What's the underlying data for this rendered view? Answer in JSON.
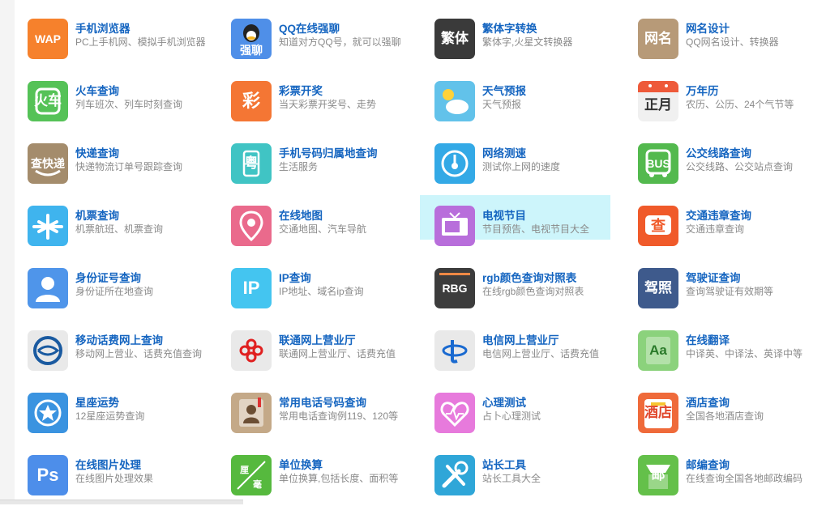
{
  "tiles": [
    {
      "title": "手机浏览器",
      "desc": "PC上手机网、模拟手机浏览器",
      "icon": "wap-icon",
      "icon_text": "WAP",
      "color": "#f6812c"
    },
    {
      "title": "QQ在线强聊",
      "desc": "知道对方QQ号，就可以强聊",
      "icon": "qq-penguin-icon",
      "icon_text": "强聊",
      "color": "#4f8fe8"
    },
    {
      "title": "繁体字转换",
      "desc": "繁体字,火星文转换器",
      "icon": "traditional-chinese-icon",
      "icon_text": "繁体",
      "color": "#3a3a3a"
    },
    {
      "title": "网名设计",
      "desc": "QQ网名设计、转换器",
      "icon": "nickname-icon",
      "icon_text": "网名",
      "color": "#b79a78"
    },
    {
      "title": "火车查询",
      "desc": "列车班次、列车时刻查询",
      "icon": "train-icon",
      "icon_text": "火车",
      "color": "#55c257"
    },
    {
      "title": "彩票开奖",
      "desc": "当天彩票开奖号、走势",
      "icon": "lottery-icon",
      "icon_text": "彩",
      "color": "#f47634"
    },
    {
      "title": "天气预报",
      "desc": "天气预报",
      "icon": "weather-icon",
      "icon_text": "",
      "color": "#62c2ea"
    },
    {
      "title": "万年历",
      "desc": "农历、公历、24个气节等",
      "icon": "calendar-icon",
      "icon_text": "正月",
      "color": "#f0f0f0"
    },
    {
      "title": "快递查询",
      "desc": "快递物流订单号跟踪查询",
      "icon": "express-icon",
      "icon_text": "查快递",
      "color": "#a48c6c"
    },
    {
      "title": "手机号码归属地查询",
      "desc": "生活服务",
      "icon": "phone-location-icon",
      "icon_text": "粤",
      "color": "#40c4c4"
    },
    {
      "title": "网络测速",
      "desc": "测试你上网的速度",
      "icon": "speedometer-icon",
      "icon_text": "",
      "color": "#33a9e6"
    },
    {
      "title": "公交线路查询",
      "desc": "公交线路、公交站点查询",
      "icon": "bus-icon",
      "icon_text": "BUS",
      "color": "#53b94e"
    },
    {
      "title": "机票查询",
      "desc": "机票航班、机票查询",
      "icon": "airplane-icon",
      "icon_text": "",
      "color": "#3fb4ee"
    },
    {
      "title": "在线地图",
      "desc": "交通地图、汽车导航",
      "icon": "map-pin-icon",
      "icon_text": "",
      "color": "#ea6a8c"
    },
    {
      "title": "电视节目",
      "desc": "节目预告、电视节目大全",
      "icon": "tv-icon",
      "icon_text": "",
      "color": "#b86edb"
    },
    {
      "title": "交通违章查询",
      "desc": "交通违章查询",
      "icon": "traffic-violation-icon",
      "icon_text": "查",
      "color": "#f05a2a"
    },
    {
      "title": "身份证号查询",
      "desc": "身份证所在地查询",
      "icon": "id-card-icon",
      "icon_text": "",
      "color": "#4f95ea"
    },
    {
      "title": "IP查询",
      "desc": "IP地址、域名ip查询",
      "icon": "ip-icon",
      "icon_text": "IP",
      "color": "#44c5f0"
    },
    {
      "title": "rgb颜色查询对照表",
      "desc": "在线rgb颜色查询对照表",
      "icon": "rgb-icon",
      "icon_text": "RBG",
      "color": "#3c3c3c"
    },
    {
      "title": "驾驶证查询",
      "desc": "查询驾驶证有效期等",
      "icon": "driver-license-icon",
      "icon_text": "驾照",
      "color": "#3e5a8c"
    },
    {
      "title": "移动话费网上查询",
      "desc": "移动网上营业、话费充值查询",
      "icon": "china-mobile-icon",
      "icon_text": "",
      "color": "#e9e9e9"
    },
    {
      "title": "联通网上营业厅",
      "desc": "联通网上营业厅、话费充值",
      "icon": "china-unicom-icon",
      "icon_text": "",
      "color": "#e9e9e9"
    },
    {
      "title": "电信网上营业厅",
      "desc": "电信网上营业厅、话费充值",
      "icon": "china-telecom-icon",
      "icon_text": "",
      "color": "#e9e9e9"
    },
    {
      "title": "在线翻译",
      "desc": "中译英、中译法、英译中等",
      "icon": "translate-icon",
      "icon_text": "Aa",
      "color": "#8bd27c"
    },
    {
      "title": "星座运势",
      "desc": "12星座运势查询",
      "icon": "constellation-icon",
      "icon_text": "",
      "color": "#3a93e0"
    },
    {
      "title": "常用电话号码查询",
      "desc": "常用电话查询例119、120等",
      "icon": "contacts-icon",
      "icon_text": "",
      "color": "#c4a988"
    },
    {
      "title": "心理测试",
      "desc": "占卜心理测试",
      "icon": "heart-icon",
      "icon_text": "",
      "color": "#e77adc"
    },
    {
      "title": "酒店查询",
      "desc": "全国各地酒店查询",
      "icon": "hotel-icon",
      "icon_text": "酒店",
      "color": "#ef6a3a"
    },
    {
      "title": "在线图片处理",
      "desc": "在线图片处理效果",
      "icon": "photoshop-icon",
      "icon_text": "Ps",
      "color": "#4d8eea"
    },
    {
      "title": "单位换算",
      "desc": "单位换算,包括长度、面积等",
      "icon": "unit-convert-icon",
      "icon_text": "",
      "color": "#56b93e"
    },
    {
      "title": "站长工具",
      "desc": "站长工具大全",
      "icon": "tools-icon",
      "icon_text": "",
      "color": "#2fa6d8"
    },
    {
      "title": "邮编查询",
      "desc": "在线查询全国各地邮政编码",
      "icon": "postcode-icon",
      "icon_text": "邮",
      "color": "#64c04a"
    }
  ],
  "highlighted": "电视节目"
}
